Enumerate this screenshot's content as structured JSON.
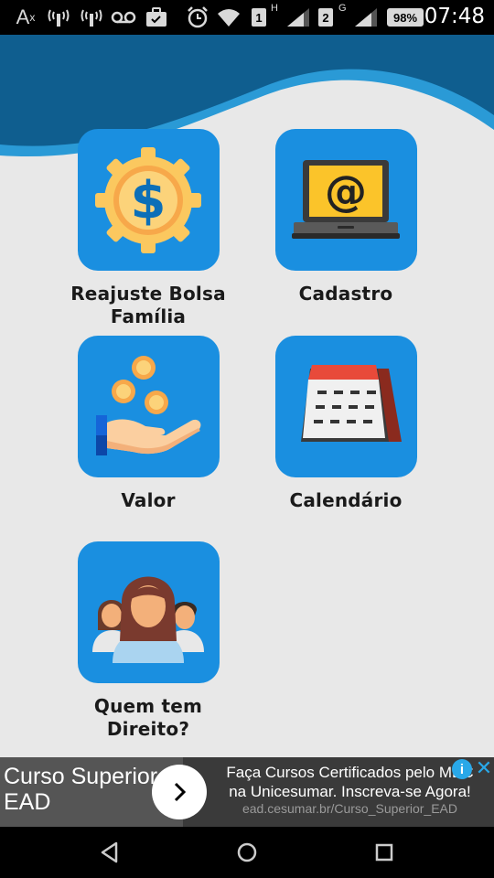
{
  "status_bar": {
    "carrier_icon": "A",
    "carrier_superscript": "x",
    "sim1_label": "1",
    "sim2_label": "2",
    "network1": "H",
    "network2": "G",
    "battery": "98%",
    "time": "07:48",
    "icons": [
      "accessibility-icon",
      "signal-sim1-icon",
      "signal-sim2-icon",
      "voicemail-icon",
      "briefcase-icon",
      "alarm-icon",
      "wifi-icon",
      "cell-signal-icon",
      "battery-icon"
    ]
  },
  "menu": {
    "items": [
      {
        "label": "Reajuste Bolsa Família",
        "label_line1": "Reajuste Bolsa",
        "label_line2": "Família",
        "icon": "dollar-gear-icon"
      },
      {
        "label": "Cadastro",
        "icon": "laptop-at-icon"
      },
      {
        "label": "Valor",
        "icon": "hand-coins-icon"
      },
      {
        "label": "Calendário",
        "icon": "calendar-icon"
      },
      {
        "label": "Quem tem Direito?",
        "label_line1": "Quem tem",
        "label_line2": "Direito?",
        "icon": "people-group-icon"
      }
    ]
  },
  "ad": {
    "left_text_line1": "Curso Superior",
    "left_text_line2": "EAD",
    "title": "Faça Cursos Certificados pelo MEC na Unicesumar. Inscreva-se Agora!",
    "url": "ead.cesumar.br/Curso_Superior_EAD",
    "info_symbol": "i",
    "close_symbol": "✕"
  },
  "colors": {
    "tile_blue": "#1a8fe0",
    "header_dark": "#0f5e8f",
    "header_light": "#2a9ad6",
    "background": "#e8e8e8"
  }
}
